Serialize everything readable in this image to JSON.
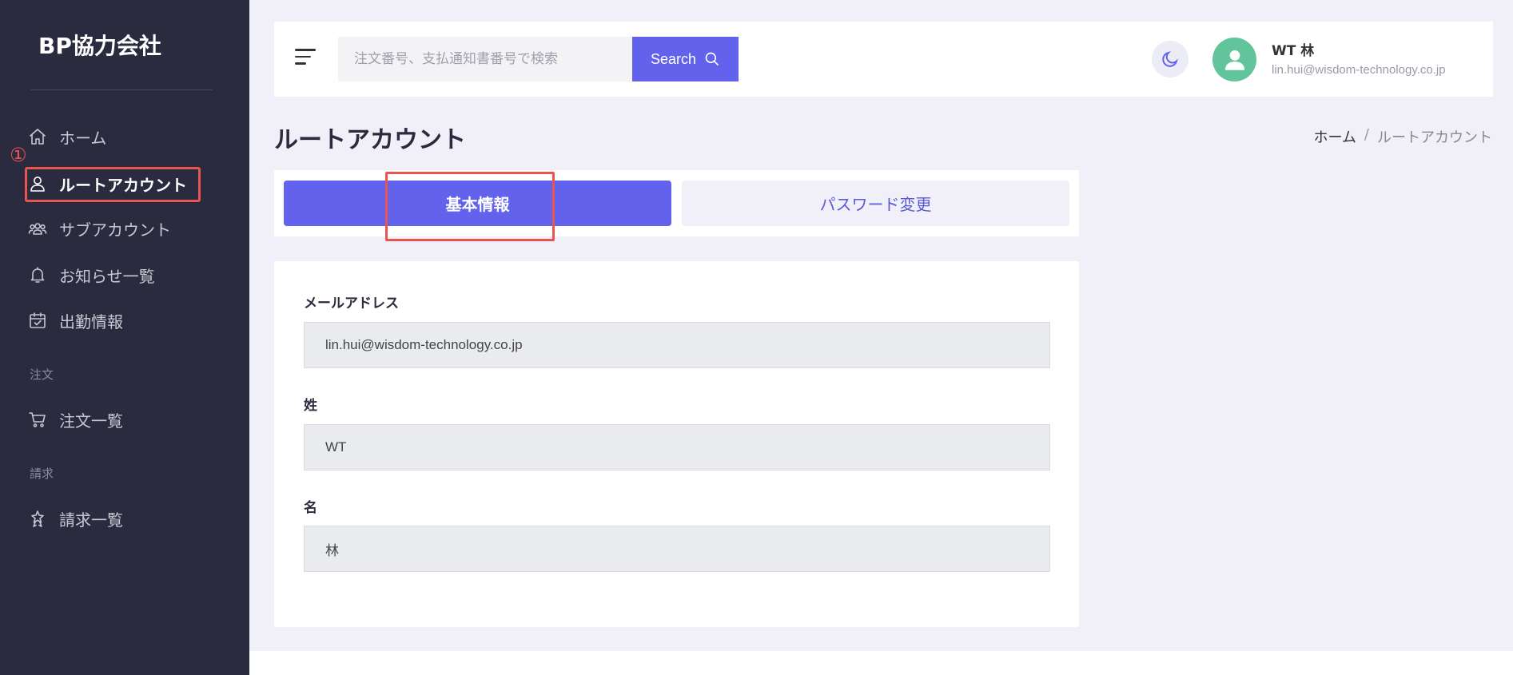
{
  "sidebar": {
    "brand": "BP協力会社",
    "marker": "①",
    "items": [
      {
        "label": "ホーム",
        "icon": "home-icon"
      },
      {
        "label": "ルートアカウント",
        "icon": "user-icon"
      },
      {
        "label": "サブアカウント",
        "icon": "users-icon"
      },
      {
        "label": "お知らせ一覧",
        "icon": "bell-icon"
      },
      {
        "label": "出勤情報",
        "icon": "calendar-check-icon"
      }
    ],
    "section_order": "注文",
    "order_items": [
      {
        "label": "注文一覧",
        "icon": "cart-icon"
      }
    ],
    "section_invoice": "請求",
    "invoice_items": [
      {
        "label": "請求一覧",
        "icon": "award-icon"
      }
    ]
  },
  "header": {
    "search_placeholder": "注文番号、支払通知書番号で検索",
    "search_button": "Search",
    "user_name": "WT 林",
    "user_email": "lin.hui@wisdom-technology.co.jp"
  },
  "page": {
    "title": "ルートアカウント",
    "breadcrumb_home": "ホーム",
    "breadcrumb_sep": "/",
    "breadcrumb_current": "ルートアカウント"
  },
  "tabs": {
    "basic": "基本情報",
    "password": "パスワード変更"
  },
  "form": {
    "email_label": "メールアドレス",
    "email_value": "lin.hui@wisdom-technology.co.jp",
    "last_name_label": "姓",
    "last_name_value": "WT",
    "first_name_label": "名",
    "first_name_value": "林"
  },
  "colors": {
    "sidebar_bg": "#2b2b3f",
    "accent": "#6262ec",
    "annotation": "#e8554e",
    "avatar_bg": "#62c49a"
  }
}
